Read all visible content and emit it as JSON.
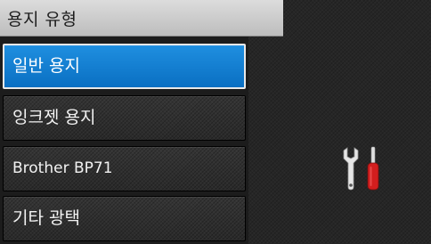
{
  "header": {
    "title": "용지 유형"
  },
  "menu": {
    "items": [
      {
        "label": "일반 용지",
        "selected": true
      },
      {
        "label": "잉크젯 용지",
        "selected": false
      },
      {
        "label": "Brother BP71",
        "selected": false
      },
      {
        "label": "기타 광택",
        "selected": false
      }
    ]
  },
  "side": {
    "icon": "settings-tools-icon"
  },
  "colors": {
    "selected": "#1a85d6",
    "tool_handle": "#d21e1e",
    "tool_metal": "#e6e6e6"
  }
}
